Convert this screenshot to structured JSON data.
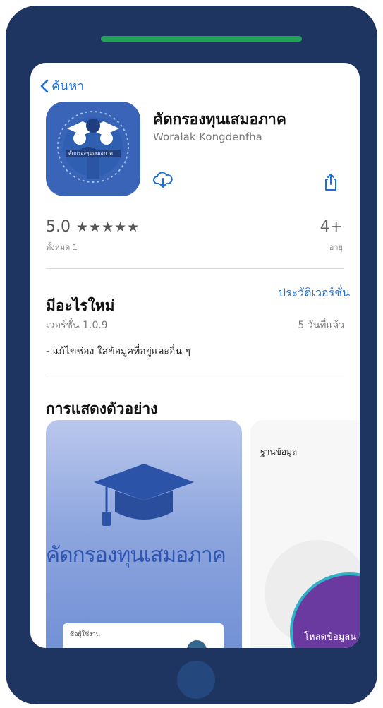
{
  "nav": {
    "back_label": "ค้นหา"
  },
  "app": {
    "name": "คัดกรองทุนเสมอภาค",
    "developer": "Woralak Kongdenfha",
    "icon_caption": "คัดกรองทุนเสมอภาค"
  },
  "ratings": {
    "score": "5.0",
    "stars": "★★★★★",
    "count_label": "ทั้งหมด 1",
    "age": "4+",
    "age_label": "อายุ"
  },
  "whats_new": {
    "title": "มีอะไรใหม่",
    "history_link": "ประวัติเวอร์ชั่น",
    "version": "เวอร์ชั่น 1.0.9",
    "time_ago": "5 วันที่แล้ว",
    "notes": "- แก้ไขช่อง ใส่ข้อมูลที่อยู่และอื่น ๆ"
  },
  "preview": {
    "title": "การแสดงตัวอย่าง",
    "shot1": {
      "title": "คัดกรองทุนเสมอภาค",
      "field_label": "ชื่อผู้ใช้งาน",
      "go_icon": "→"
    },
    "shot2": {
      "heading": "ฐานข้อมูล",
      "button": "โหลดข้อมูลน"
    }
  },
  "colors": {
    "frame": "#1e3461",
    "speaker": "#23a05a",
    "link": "#1e6fd9"
  }
}
